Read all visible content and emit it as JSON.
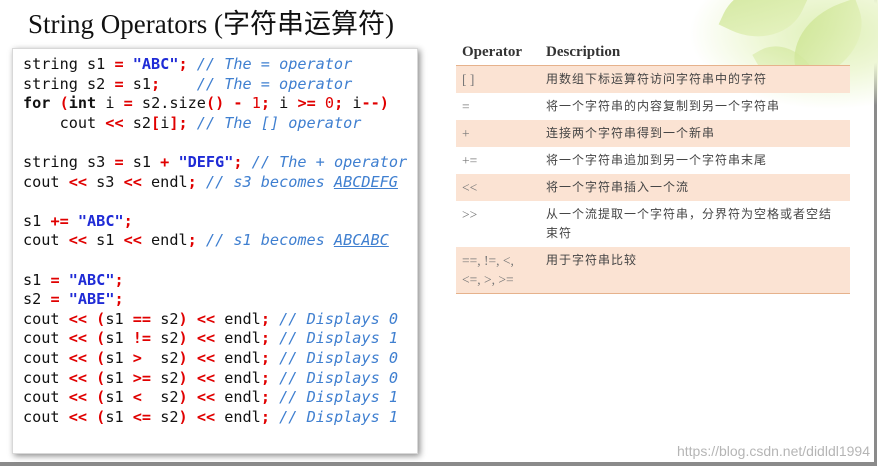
{
  "title": "String Operators (字符串运算符)",
  "code_lines": [
    {
      "id": "l1",
      "parts": [
        [
          "",
          "string s1 "
        ],
        [
          "op",
          "="
        ],
        [
          "",
          " "
        ],
        [
          "str",
          "\"ABC\""
        ],
        [
          "op",
          ";"
        ],
        [
          "",
          " "
        ],
        [
          "cmt",
          "// The = operator"
        ]
      ]
    },
    {
      "id": "l2",
      "parts": [
        [
          "",
          "string s2 "
        ],
        [
          "op",
          "="
        ],
        [
          "",
          " s1"
        ],
        [
          "op",
          ";"
        ],
        [
          "",
          "    "
        ],
        [
          "cmt",
          "// The = operator"
        ]
      ]
    },
    {
      "id": "l3",
      "parts": [
        [
          "kw",
          "for"
        ],
        [
          "",
          " "
        ],
        [
          "op",
          "("
        ],
        [
          "kw",
          "int"
        ],
        [
          "",
          " i "
        ],
        [
          "op",
          "="
        ],
        [
          "",
          " s2.size"
        ],
        [
          "op",
          "()"
        ],
        [
          "",
          " "
        ],
        [
          "op",
          "-"
        ],
        [
          "",
          " "
        ],
        [
          "num",
          "1"
        ],
        [
          "op",
          ";"
        ],
        [
          "",
          " i "
        ],
        [
          "op",
          ">="
        ],
        [
          "",
          " "
        ],
        [
          "num",
          "0"
        ],
        [
          "op",
          ";"
        ],
        [
          "",
          " i"
        ],
        [
          "op",
          "--)"
        ]
      ]
    },
    {
      "id": "l4",
      "parts": [
        [
          "",
          "    cout "
        ],
        [
          "op",
          "<<"
        ],
        [
          "",
          " s2"
        ],
        [
          "op",
          "["
        ],
        [
          "",
          "i"
        ],
        [
          "op",
          "];"
        ],
        [
          "",
          " "
        ],
        [
          "cmt",
          "// The [] operator"
        ]
      ]
    },
    {
      "id": "l5",
      "parts": [
        [
          "",
          " "
        ]
      ]
    },
    {
      "id": "l6",
      "parts": [
        [
          "",
          "string s3 "
        ],
        [
          "op",
          "="
        ],
        [
          "",
          " s1 "
        ],
        [
          "op",
          "+"
        ],
        [
          "",
          " "
        ],
        [
          "str",
          "\"DEFG\""
        ],
        [
          "op",
          ";"
        ],
        [
          "",
          " "
        ],
        [
          "cmt",
          "// The + operator"
        ]
      ]
    },
    {
      "id": "l7",
      "parts": [
        [
          "",
          "cout "
        ],
        [
          "op",
          "<<"
        ],
        [
          "",
          " s3 "
        ],
        [
          "op",
          "<<"
        ],
        [
          "",
          " endl"
        ],
        [
          "op",
          ";"
        ],
        [
          "",
          " "
        ],
        [
          "cmt",
          "// s3 becomes "
        ],
        [
          "cmt-u",
          "ABCDEFG"
        ]
      ]
    },
    {
      "id": "l8",
      "parts": [
        [
          "",
          " "
        ]
      ]
    },
    {
      "id": "l9",
      "parts": [
        [
          "",
          "s1 "
        ],
        [
          "op",
          "+="
        ],
        [
          "",
          " "
        ],
        [
          "str",
          "\"ABC\""
        ],
        [
          "op",
          ";"
        ]
      ]
    },
    {
      "id": "l10",
      "parts": [
        [
          "",
          "cout "
        ],
        [
          "op",
          "<<"
        ],
        [
          "",
          " s1 "
        ],
        [
          "op",
          "<<"
        ],
        [
          "",
          " endl"
        ],
        [
          "op",
          ";"
        ],
        [
          "",
          " "
        ],
        [
          "cmt",
          "// s1 becomes "
        ],
        [
          "cmt-u",
          "ABCABC"
        ]
      ]
    },
    {
      "id": "l11",
      "parts": [
        [
          "",
          " "
        ]
      ]
    },
    {
      "id": "l12",
      "parts": [
        [
          "",
          "s1 "
        ],
        [
          "op",
          "="
        ],
        [
          "",
          " "
        ],
        [
          "str",
          "\"ABC\""
        ],
        [
          "op",
          ";"
        ]
      ]
    },
    {
      "id": "l13",
      "parts": [
        [
          "",
          "s2 "
        ],
        [
          "op",
          "="
        ],
        [
          "",
          " "
        ],
        [
          "str",
          "\"ABE\""
        ],
        [
          "op",
          ";"
        ]
      ]
    },
    {
      "id": "l14",
      "parts": [
        [
          "",
          "cout "
        ],
        [
          "op",
          "<<"
        ],
        [
          "",
          " "
        ],
        [
          "op",
          "("
        ],
        [
          "",
          "s1 "
        ],
        [
          "op",
          "=="
        ],
        [
          "",
          " s2"
        ],
        [
          "op",
          ")"
        ],
        [
          "",
          " "
        ],
        [
          "op",
          "<<"
        ],
        [
          "",
          " endl"
        ],
        [
          "op",
          ";"
        ],
        [
          "",
          " "
        ],
        [
          "cmt",
          "// Displays 0"
        ]
      ]
    },
    {
      "id": "l15",
      "parts": [
        [
          "",
          "cout "
        ],
        [
          "op",
          "<<"
        ],
        [
          "",
          " "
        ],
        [
          "op",
          "("
        ],
        [
          "",
          "s1 "
        ],
        [
          "op",
          "!="
        ],
        [
          "",
          " s2"
        ],
        [
          "op",
          ")"
        ],
        [
          "",
          " "
        ],
        [
          "op",
          "<<"
        ],
        [
          "",
          " endl"
        ],
        [
          "op",
          ";"
        ],
        [
          "",
          " "
        ],
        [
          "cmt",
          "// Displays 1"
        ]
      ]
    },
    {
      "id": "l16",
      "parts": [
        [
          "",
          "cout "
        ],
        [
          "op",
          "<<"
        ],
        [
          "",
          " "
        ],
        [
          "op",
          "("
        ],
        [
          "",
          "s1 "
        ],
        [
          "op",
          ">"
        ],
        [
          "",
          "  s2"
        ],
        [
          "op",
          ")"
        ],
        [
          "",
          " "
        ],
        [
          "op",
          "<<"
        ],
        [
          "",
          " endl"
        ],
        [
          "op",
          ";"
        ],
        [
          "",
          " "
        ],
        [
          "cmt",
          "// Displays 0"
        ]
      ]
    },
    {
      "id": "l17",
      "parts": [
        [
          "",
          "cout "
        ],
        [
          "op",
          "<<"
        ],
        [
          "",
          " "
        ],
        [
          "op",
          "("
        ],
        [
          "",
          "s1 "
        ],
        [
          "op",
          ">="
        ],
        [
          "",
          " s2"
        ],
        [
          "op",
          ")"
        ],
        [
          "",
          " "
        ],
        [
          "op",
          "<<"
        ],
        [
          "",
          " endl"
        ],
        [
          "op",
          ";"
        ],
        [
          "",
          " "
        ],
        [
          "cmt",
          "// Displays 0"
        ]
      ]
    },
    {
      "id": "l18",
      "parts": [
        [
          "",
          "cout "
        ],
        [
          "op",
          "<<"
        ],
        [
          "",
          " "
        ],
        [
          "op",
          "("
        ],
        [
          "",
          "s1 "
        ],
        [
          "op",
          "<"
        ],
        [
          "",
          "  s2"
        ],
        [
          "op",
          ")"
        ],
        [
          "",
          " "
        ],
        [
          "op",
          "<<"
        ],
        [
          "",
          " endl"
        ],
        [
          "op",
          ";"
        ],
        [
          "",
          " "
        ],
        [
          "cmt",
          "// Displays 1"
        ]
      ]
    },
    {
      "id": "l19",
      "parts": [
        [
          "",
          "cout "
        ],
        [
          "op",
          "<<"
        ],
        [
          "",
          " "
        ],
        [
          "op",
          "("
        ],
        [
          "",
          "s1 "
        ],
        [
          "op",
          "<="
        ],
        [
          "",
          " s2"
        ],
        [
          "op",
          ")"
        ],
        [
          "",
          " "
        ],
        [
          "op",
          "<<"
        ],
        [
          "",
          " endl"
        ],
        [
          "op",
          ";"
        ],
        [
          "",
          " "
        ],
        [
          "cmt",
          "// Displays 1"
        ]
      ]
    }
  ],
  "table": {
    "headers": {
      "operator": "Operator",
      "description": "Description"
    },
    "rows": [
      {
        "op": "[ ]",
        "desc": "用数组下标运算符访问字符串中的字符",
        "shaded": true
      },
      {
        "op": "=",
        "desc": "将一个字符串的内容复制到另一个字符串",
        "shaded": false
      },
      {
        "op": "+",
        "desc": "连接两个字符串得到一个新串",
        "shaded": true
      },
      {
        "op": "+=",
        "desc": "将一个字符串追加到另一个字符串末尾",
        "shaded": false
      },
      {
        "op": "<<",
        "desc": "将一个字符串插入一个流",
        "shaded": true
      },
      {
        "op": ">>",
        "desc": "从一个流提取一个字符串，分界符为空格或者空结束符",
        "shaded": false
      },
      {
        "op": "==, !=, <, <=, >, >=",
        "desc": "用于字符串比较",
        "shaded": true
      }
    ]
  },
  "watermark": "https://blog.csdn.net/didldl1994"
}
